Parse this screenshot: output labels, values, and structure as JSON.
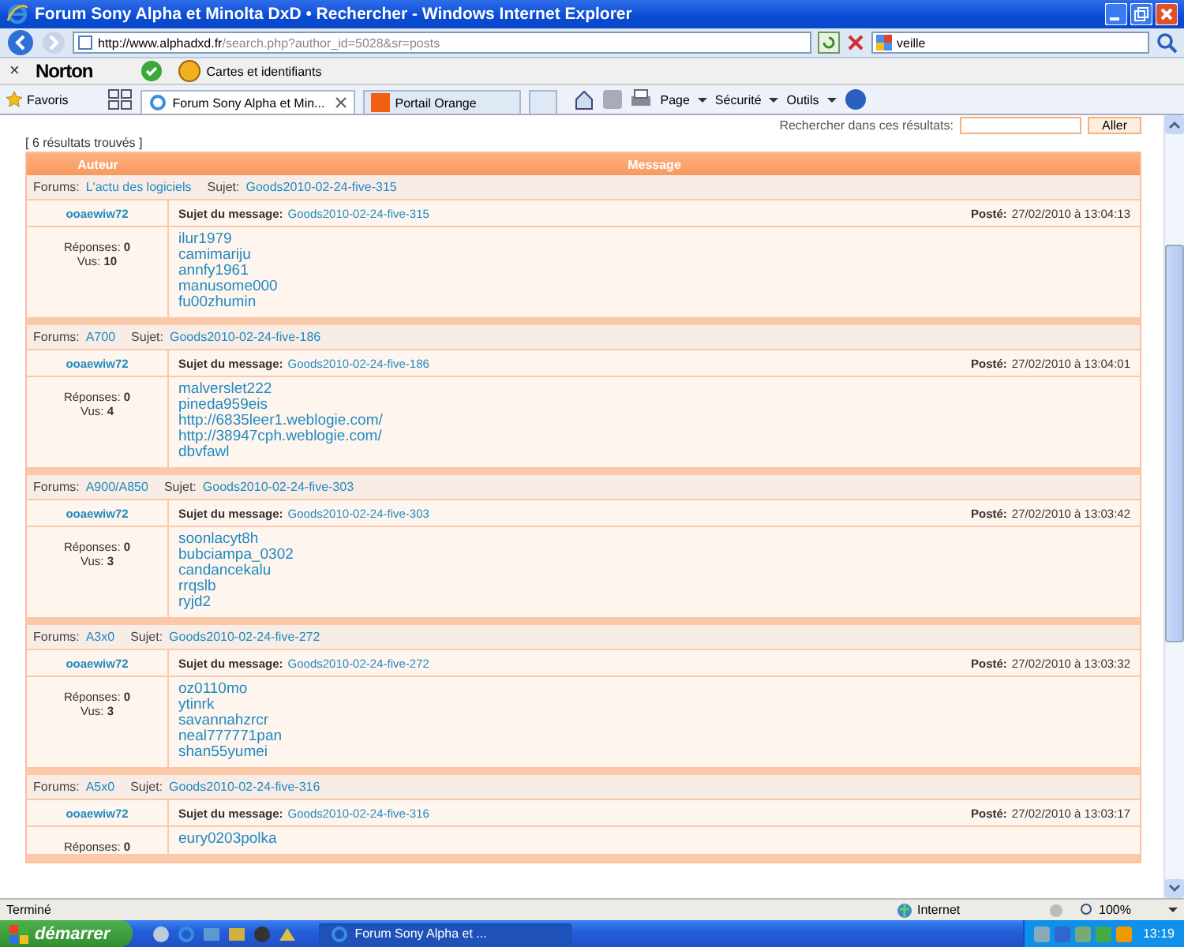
{
  "window": {
    "title": "Forum Sony Alpha et Minolta DxD • Rechercher - Windows Internet Explorer"
  },
  "address_bar": {
    "url_host": "http://www.alphadxd.fr",
    "url_path": "/search.php?author_id=5028&sr=posts",
    "search_value": "veille"
  },
  "norton_bar": {
    "close": "×",
    "brand": "Norton",
    "identity_button": "Cartes et identifiants"
  },
  "favorites_bar": {
    "favorites": "Favoris",
    "tabs": [
      {
        "label": "Forum Sony Alpha et Min...",
        "selected": true
      },
      {
        "label": "Portail Orange",
        "selected": false
      }
    ],
    "commands": [
      "Page",
      "Sécurité",
      "Outils"
    ]
  },
  "page": {
    "search_in_results_label": "Rechercher dans ces résultats:",
    "go_button": "Aller",
    "results_count": "[ 6 résultats trouvés ]",
    "columns": [
      "Auteur",
      "Message"
    ],
    "results": [
      {
        "forum_label": "Forums:",
        "forum": "L'actu des logiciels",
        "topic_label": "Sujet:",
        "topic": "Goods2010-02-24-five-315",
        "author": "ooaewiw72",
        "subject_label": "Sujet du message:",
        "subject": "Goods2010-02-24-five-315",
        "posted_label": "Posté:",
        "posted": "27/02/2010 à 13:04:13",
        "replies_label": "Réponses:",
        "replies": "0",
        "views_label": "Vus:",
        "views": "10",
        "lines": [
          "ilur1979",
          "camimariju",
          "annfy1961",
          "manusome000",
          "fu00zhumin"
        ]
      },
      {
        "forum_label": "Forums:",
        "forum": "A700",
        "topic_label": "Sujet:",
        "topic": "Goods2010-02-24-five-186",
        "author": "ooaewiw72",
        "subject_label": "Sujet du message:",
        "subject": "Goods2010-02-24-five-186",
        "posted_label": "Posté:",
        "posted": "27/02/2010 à 13:04:01",
        "replies_label": "Réponses:",
        "replies": "0",
        "views_label": "Vus:",
        "views": "4",
        "lines": [
          "malverslet222",
          "pineda959eis",
          "http://6835leer1.weblogie.com/",
          "http://38947cph.weblogie.com/",
          "dbvfawl"
        ]
      },
      {
        "forum_label": "Forums:",
        "forum": "A900/A850",
        "topic_label": "Sujet:",
        "topic": "Goods2010-02-24-five-303",
        "author": "ooaewiw72",
        "subject_label": "Sujet du message:",
        "subject": "Goods2010-02-24-five-303",
        "posted_label": "Posté:",
        "posted": "27/02/2010 à 13:03:42",
        "replies_label": "Réponses:",
        "replies": "0",
        "views_label": "Vus:",
        "views": "3",
        "lines": [
          "soonlacyt8h",
          "bubciampa_0302",
          "candancekalu",
          "rrqslb",
          "ryjd2"
        ]
      },
      {
        "forum_label": "Forums:",
        "forum": "A3x0",
        "topic_label": "Sujet:",
        "topic": "Goods2010-02-24-five-272",
        "author": "ooaewiw72",
        "subject_label": "Sujet du message:",
        "subject": "Goods2010-02-24-five-272",
        "posted_label": "Posté:",
        "posted": "27/02/2010 à 13:03:32",
        "replies_label": "Réponses:",
        "replies": "0",
        "views_label": "Vus:",
        "views": "3",
        "lines": [
          "oz0110mo",
          "ytinrk",
          "savannahzrcr",
          "neal777771pan",
          "shan55yumei"
        ]
      },
      {
        "forum_label": "Forums:",
        "forum": "A5x0",
        "topic_label": "Sujet:",
        "topic": "Goods2010-02-24-five-316",
        "author": "ooaewiw72",
        "subject_label": "Sujet du message:",
        "subject": "Goods2010-02-24-five-316",
        "posted_label": "Posté:",
        "posted": "27/02/2010 à 13:03:17",
        "replies_label": "Réponses:",
        "replies": "0",
        "lines": [
          "eury0203polka"
        ]
      }
    ]
  },
  "status_bar": {
    "status": "Terminé",
    "zone": "Internet",
    "zoom": "100%"
  },
  "taskbar": {
    "start": "démarrer",
    "tasks": [
      {
        "label": "Forum Sony Alpha et ...",
        "selected": true
      }
    ],
    "clock": "13:19"
  }
}
